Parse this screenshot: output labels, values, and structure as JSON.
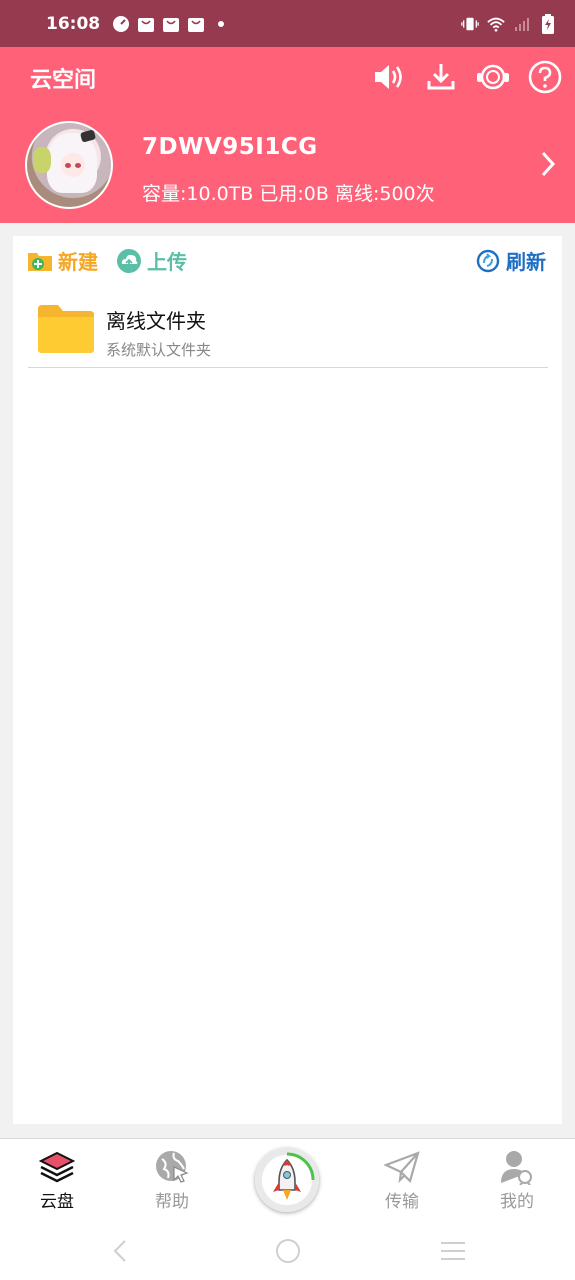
{
  "status_bar": {
    "time": "16:08",
    "left_icons": [
      "gauge-icon",
      "shopping-bag-icon",
      "shopping-bag-icon",
      "shopping-bag-icon",
      "dot-icon"
    ],
    "right_icons": [
      "vibrate-icon",
      "wifi-icon",
      "signal-icon",
      "battery-charging-icon"
    ]
  },
  "header": {
    "title": "云空间",
    "username": "7DWV95I1CG",
    "stats": "容量:10.0TB 已用:0B 离线:500次",
    "background_color": "#ff6179",
    "icons": [
      "speaker-icon",
      "download-icon",
      "headset-icon",
      "help-icon"
    ]
  },
  "toolbar": {
    "new_label": "新建",
    "upload_label": "上传",
    "refresh_label": "刷新"
  },
  "files": [
    {
      "name": "离线文件夹",
      "description": "系统默认文件夹",
      "icon": "folder-icon"
    }
  ],
  "bottom_nav": {
    "items": [
      {
        "label": "云盘",
        "icon": "layers-icon",
        "active": true
      },
      {
        "label": "帮助",
        "icon": "globe-cursor-icon",
        "active": false
      },
      {
        "label": "",
        "icon": "rocket-icon",
        "active": false
      },
      {
        "label": "传输",
        "icon": "paper-plane-icon",
        "active": false
      },
      {
        "label": "我的",
        "icon": "user-badge-icon",
        "active": false
      }
    ]
  },
  "system_nav": [
    "back-icon",
    "home-icon",
    "menu-icon"
  ]
}
